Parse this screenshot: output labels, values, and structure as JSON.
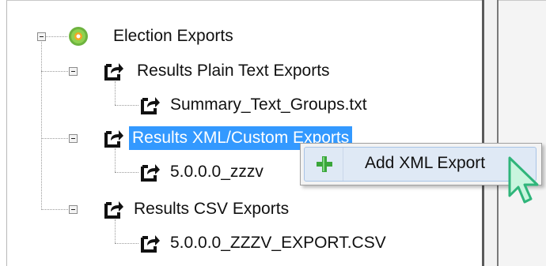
{
  "tree": {
    "root": {
      "label": "Election Exports",
      "children": [
        {
          "label": "Results Plain Text Exports",
          "children": [
            "Summary_Text_Groups.txt"
          ]
        },
        {
          "label": "Results XML/Custom Exports",
          "selected": true,
          "children": [
            "5.0.0.0_zzzv"
          ]
        },
        {
          "label": "Results CSV Exports",
          "children": [
            "5.0.0.0_ZZZV_EXPORT.CSV"
          ]
        }
      ]
    }
  },
  "context_menu": {
    "items": [
      {
        "label": "Add XML Export",
        "icon": "green-plus-icon"
      }
    ]
  },
  "colors": {
    "selection": "#3399ff",
    "menu_highlight": "#dfe9f5",
    "plus_icon": "#3aa63a",
    "cursor": "#3ecf8e"
  }
}
